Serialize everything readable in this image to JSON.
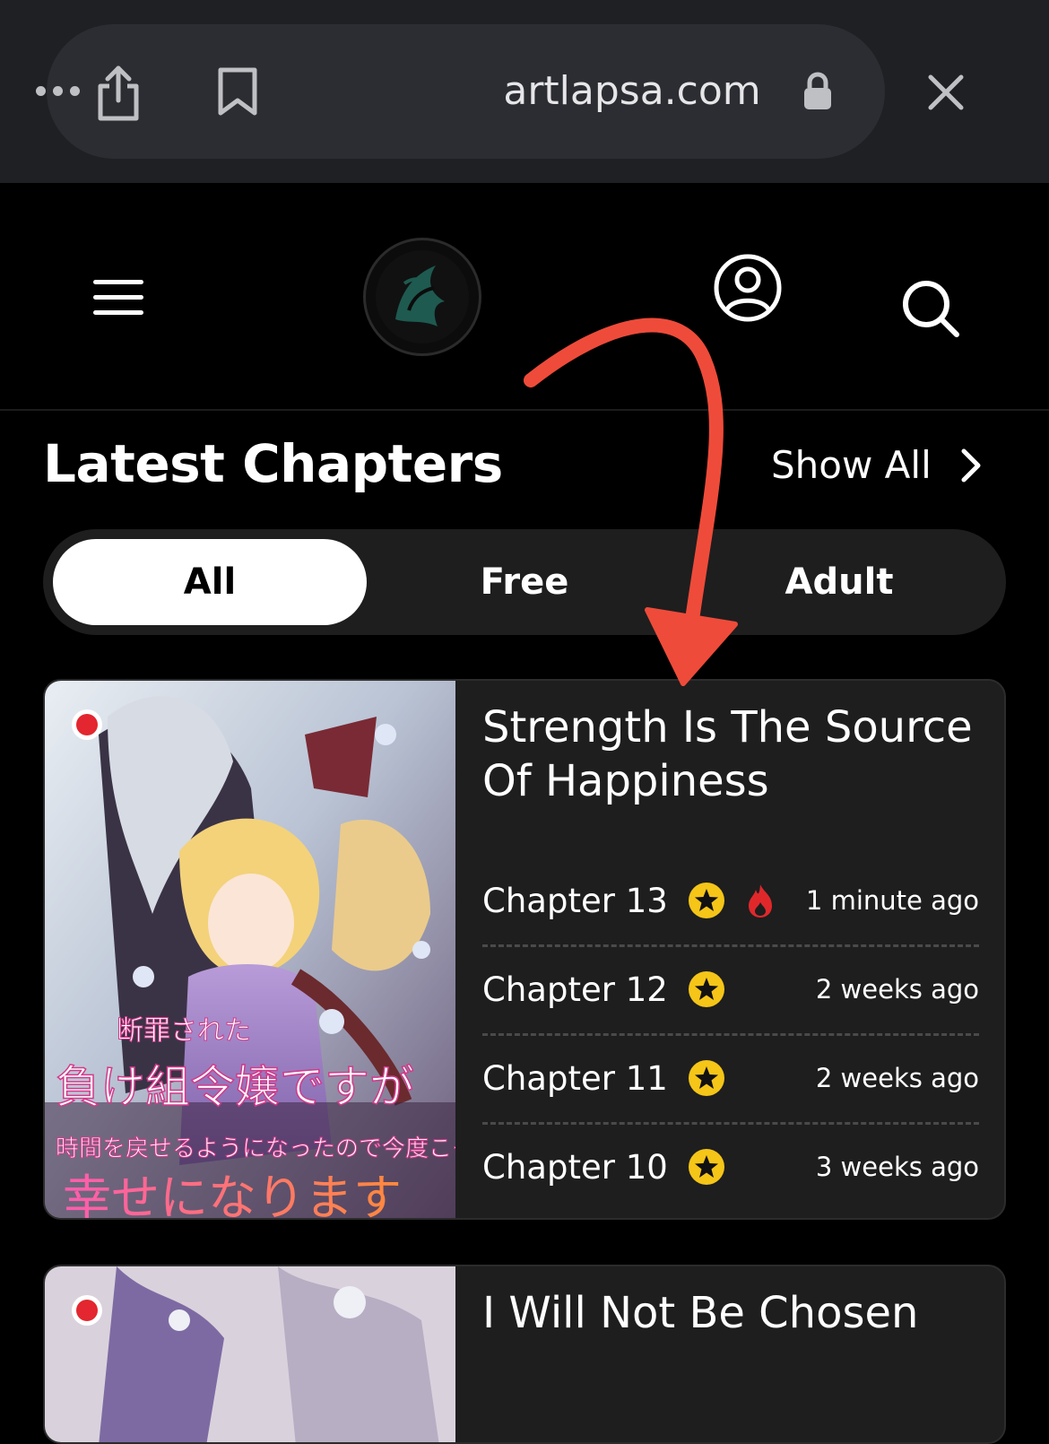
{
  "browser": {
    "url": "artlapsa.com"
  },
  "section": {
    "title": "Latest Chapters",
    "show_all": "Show All"
  },
  "tabs": [
    {
      "label": "All",
      "active": true
    },
    {
      "label": "Free",
      "active": false
    },
    {
      "label": "Adult",
      "active": false
    }
  ],
  "cards": [
    {
      "title": "Strength Is The Source Of Happiness",
      "cover_text_lines": [
        "断罪された",
        "負け組令嬢ですが",
        "時間を戻せるようになったので今度こそ",
        "幸せになります"
      ],
      "chapters": [
        {
          "name": "Chapter 13",
          "time": "1 minute ago",
          "premium": true,
          "hot": true
        },
        {
          "name": "Chapter 12",
          "time": "2 weeks ago",
          "premium": true,
          "hot": false
        },
        {
          "name": "Chapter 11",
          "time": "2 weeks ago",
          "premium": true,
          "hot": false
        },
        {
          "name": "Chapter 10",
          "time": "3 weeks ago",
          "premium": true,
          "hot": false
        }
      ]
    },
    {
      "title": "I Will Not Be Chosen"
    }
  ],
  "colors": {
    "background": "#000000",
    "card": "#1e1e1e",
    "star": "#f5c518",
    "fire": "#e0282b",
    "annotation_arrow": "#ef4b3a"
  }
}
